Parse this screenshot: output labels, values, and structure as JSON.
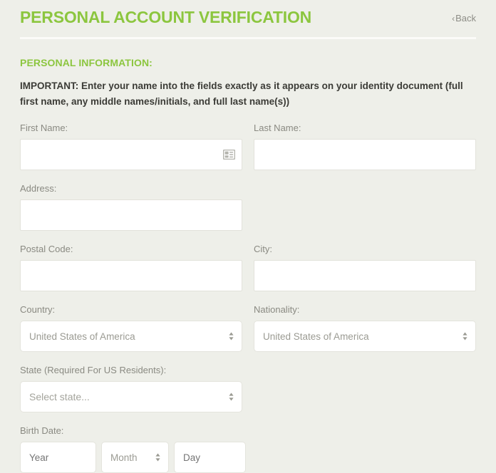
{
  "header": {
    "title": "PERSONAL ACCOUNT VERIFICATION",
    "back_label": "Back",
    "back_chevron": "‹",
    "title_color": "#8cc63f"
  },
  "section": {
    "title": "PERSONAL INFORMATION:",
    "important_note": "IMPORTANT: Enter your name into the fields exactly as it appears on your identity document (full first name, any middle names/initials, and full last name(s))"
  },
  "form": {
    "first_name": {
      "label": "First Name:",
      "value": "",
      "placeholder": "",
      "icon": "contact-card-icon"
    },
    "last_name": {
      "label": "Last Name:",
      "value": "",
      "placeholder": ""
    },
    "address": {
      "label": "Address:",
      "value": "",
      "placeholder": ""
    },
    "postal_code": {
      "label": "Postal Code:",
      "value": "",
      "placeholder": ""
    },
    "city": {
      "label": "City:",
      "value": "",
      "placeholder": ""
    },
    "country": {
      "label": "Country:",
      "selected": "United States of America"
    },
    "nationality": {
      "label": "Nationality:",
      "selected": "United States of America"
    },
    "state": {
      "label": "State (Required For US Residents):",
      "selected": "Select state..."
    },
    "birth_date": {
      "label": "Birth Date:",
      "year_placeholder": "Year",
      "month_selected": "Month",
      "day_placeholder": "Day"
    }
  },
  "colors": {
    "background": "#eeefe9",
    "accent_green": "#8cc63f",
    "label_gray": "#8a8a82",
    "text_dark": "#3b3b36",
    "input_border": "#e4e4dd",
    "input_bg": "#ffffff"
  }
}
